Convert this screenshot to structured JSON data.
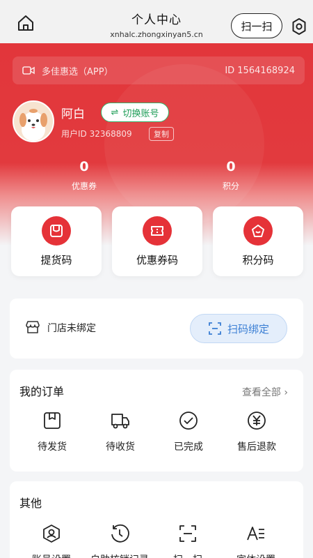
{
  "header": {
    "title": "个人中心",
    "domain": "xnhalc.zhongxinyan5.cn",
    "scan_label": "扫一扫"
  },
  "app_bar": {
    "label": "多佳惠选（APP）",
    "id_text": "ID 1564168924"
  },
  "user": {
    "name": "阿白",
    "switch_label": "切换账号",
    "user_id_text": "用户ID 32368809",
    "copy_label": "复制"
  },
  "stats": [
    {
      "value": "0",
      "label": "优惠券"
    },
    {
      "value": "0",
      "label": "积分"
    }
  ],
  "quick_codes": [
    {
      "label": "提货码",
      "icon": "bag-icon"
    },
    {
      "label": "优惠券码",
      "icon": "ticket-icon"
    },
    {
      "label": "积分码",
      "icon": "tag-icon"
    }
  ],
  "store": {
    "status": "门店未绑定",
    "bind_label": "扫码绑定"
  },
  "orders": {
    "title": "我的订单",
    "view_all": "查看全部 ›",
    "items": [
      {
        "label": "待发货",
        "icon": "package-icon"
      },
      {
        "label": "待收货",
        "icon": "truck-icon"
      },
      {
        "label": "已完成",
        "icon": "check-circle-icon"
      },
      {
        "label": "售后退款",
        "icon": "yuan-circle-icon"
      }
    ]
  },
  "others": {
    "title": "其他",
    "items": [
      {
        "label": "账号设置",
        "icon": "user-shield-icon"
      },
      {
        "label": "自助核销记录",
        "icon": "history-icon"
      },
      {
        "label": "扫一扫",
        "icon": "scan-icon"
      },
      {
        "label": "字体设置",
        "icon": "font-icon"
      }
    ]
  },
  "colors": {
    "brand_red": "#e2363b",
    "green": "#34b36b",
    "blue": "#3b7fd4"
  }
}
